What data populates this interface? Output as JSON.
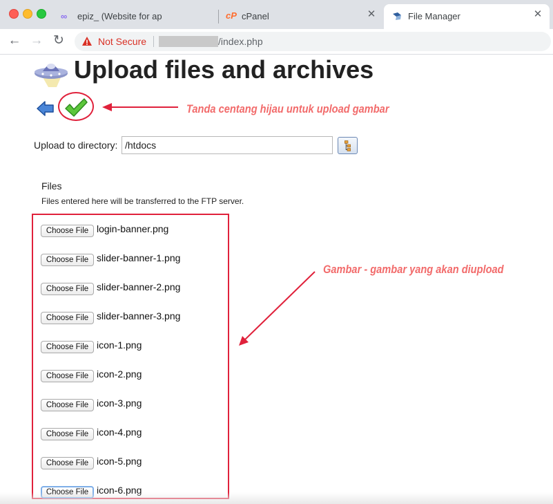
{
  "browser": {
    "tabs": [
      {
        "title": "epiz_            (Website for ap",
        "favicon": "infinity-icon",
        "active": false
      },
      {
        "title": "cPanel",
        "favicon": "cpanel-icon",
        "active": false
      },
      {
        "title": "File Manager",
        "favicon": "file-manager-icon",
        "active": true
      }
    ],
    "tab_close": "✕",
    "security_label": "Not Secure",
    "url_suffix": "/index.php"
  },
  "page": {
    "title": "Upload files and archives",
    "upload_to_label": "Upload to directory:",
    "directory_value": "/htdocs",
    "files_heading": "Files",
    "files_description": "Files entered here will be transferred to the FTP server.",
    "choose_file_label": "Choose File",
    "files": [
      "login-banner.png",
      "slider-banner-1.png",
      "slider-banner-2.png",
      "slider-banner-3.png",
      "icon-1.png",
      "icon-2.png",
      "icon-3.png",
      "icon-4.png",
      "icon-5.png",
      "icon-6.png"
    ]
  },
  "annotations": {
    "checkmark_note": "Tanda centang hijau untuk upload gambar",
    "files_note": "Gambar - gambar yang akan diupload",
    "color": "#f26b6b",
    "outline_color": "#e0213b"
  }
}
